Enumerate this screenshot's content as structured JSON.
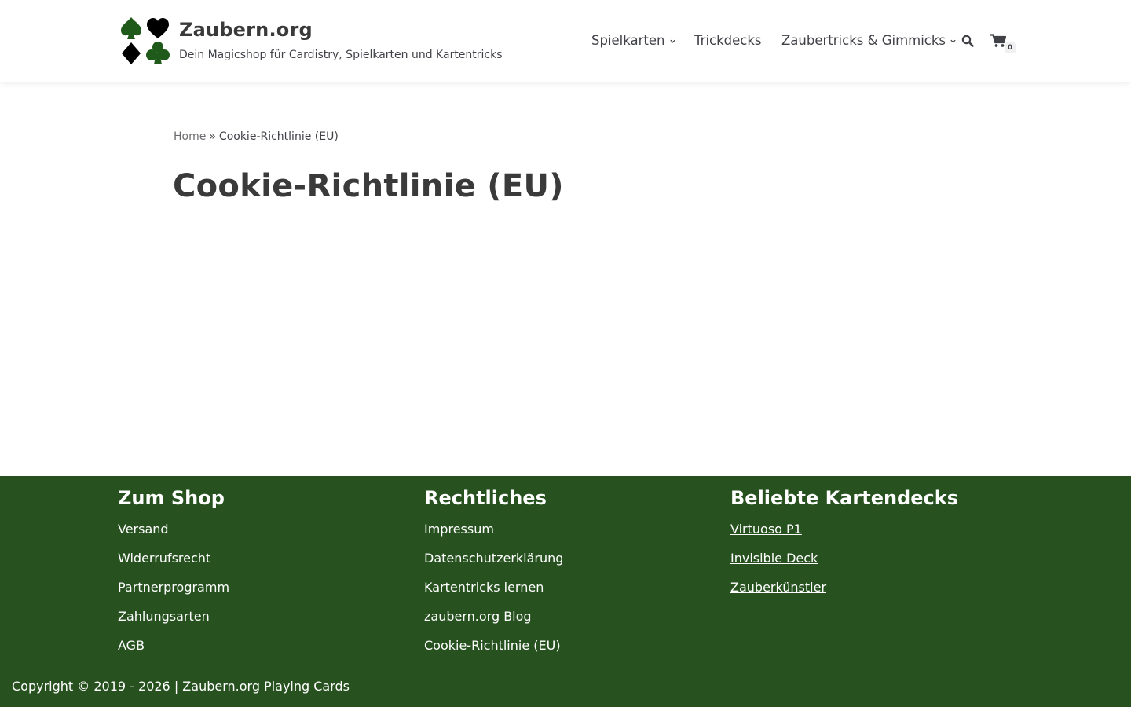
{
  "header": {
    "brand_title": "Zaubern.org",
    "brand_tagline": "Dein Magicshop für Cardistry, Spielkarten und Kartentricks",
    "logo_icons": [
      "spade-icon",
      "heart-icon",
      "diamond-icon",
      "club-icon"
    ],
    "nav": [
      {
        "label": "Spielkarten",
        "has_dropdown": true
      },
      {
        "label": "Trickdecks",
        "has_dropdown": false
      },
      {
        "label": "Zaubertricks & Gimmicks",
        "has_dropdown": true
      }
    ],
    "search_icon": "search-icon",
    "cart_icon": "cart-icon",
    "cart_count": "0"
  },
  "breadcrumb": {
    "home": "Home",
    "separator": "»",
    "current": "Cookie-Richtlinie (EU)"
  },
  "page_title": "Cookie-Richtlinie (EU)",
  "footer": {
    "columns": [
      {
        "title": "Zum Shop",
        "links": [
          "Versand",
          "Widerrufsrecht",
          "Partnerprogramm",
          "Zahlungsarten",
          "AGB"
        ]
      },
      {
        "title": "Rechtliches",
        "links": [
          "Impressum",
          "Datenschutzerklärung",
          "Kartentricks lernen",
          "zaubern.org Blog",
          "Cookie-Richtlinie (EU)"
        ]
      },
      {
        "title": "Beliebte Kartendecks",
        "links": [
          "Virtuoso P1",
          "Invisible Deck",
          "Zauberkünstler"
        ]
      }
    ],
    "copyright": "Copyright © 2019 - 2026 | Zaubern.org Playing Cards"
  },
  "colors": {
    "footer_bg": "#275220",
    "logo_green": "#1f5a1a",
    "logo_black": "#000000",
    "text": "#404248"
  }
}
